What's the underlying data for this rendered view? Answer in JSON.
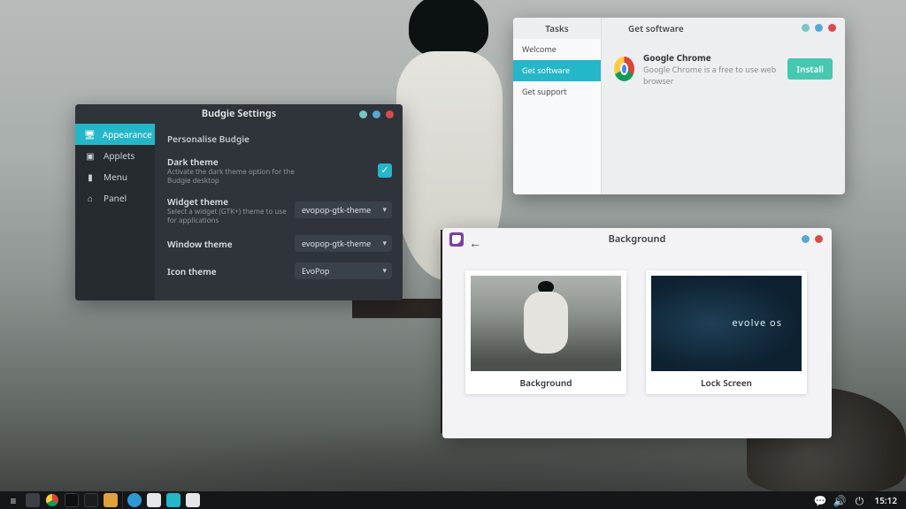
{
  "settings_window": {
    "title": "Budgie Settings",
    "sidebar": {
      "items": [
        {
          "label": "Appearance",
          "icon": "monitor-icon",
          "active": true
        },
        {
          "label": "Applets",
          "icon": "applets-icon",
          "active": false
        },
        {
          "label": "Menu",
          "icon": "document-icon",
          "active": false
        },
        {
          "label": "Panel",
          "icon": "home-icon",
          "active": false
        }
      ]
    },
    "heading": "Personalise Budgie",
    "dark_theme": {
      "title": "Dark theme",
      "desc": "Activate the dark theme option for the Budgie desktop",
      "enabled": true
    },
    "widget_theme": {
      "title": "Widget theme",
      "desc": "Select a widget (GTK+) theme to use for applications",
      "value": "evopop-gtk-theme"
    },
    "window_theme": {
      "title": "Window theme",
      "value": "evopop-gtk-theme"
    },
    "icon_theme": {
      "title": "Icon theme",
      "value": "EvoPop"
    }
  },
  "software_window": {
    "tab_tasks_label": "Tasks",
    "tab_getsoft_label": "Get software",
    "sidebar": {
      "items": [
        {
          "label": "Welcome",
          "active": false
        },
        {
          "label": "Get software",
          "active": true
        },
        {
          "label": "Get support",
          "active": false
        }
      ]
    },
    "app": {
      "name": "Google Chrome",
      "desc": "Google Chrome is a free to use web browser",
      "install_label": "Install"
    }
  },
  "background_window": {
    "title": "Background",
    "cards": [
      {
        "caption": "Background"
      },
      {
        "caption": "Lock Screen"
      }
    ],
    "lock_thumb_text": "evolve os"
  },
  "taskbar": {
    "clock": "15:12",
    "launchers": [
      "menu-icon",
      "places-icon",
      "chrome-icon",
      "terminal-icon",
      "terminal2-icon",
      "files-icon",
      "separator",
      "telegram-icon",
      "task-icon",
      "settings-icon",
      "task2-icon"
    ],
    "tray": [
      "chat-icon",
      "volume-icon",
      "power-icon"
    ]
  },
  "colors": {
    "accent": "#24b6c9",
    "install_button": "#46c7b0",
    "close_dot": "#d94b4b"
  }
}
